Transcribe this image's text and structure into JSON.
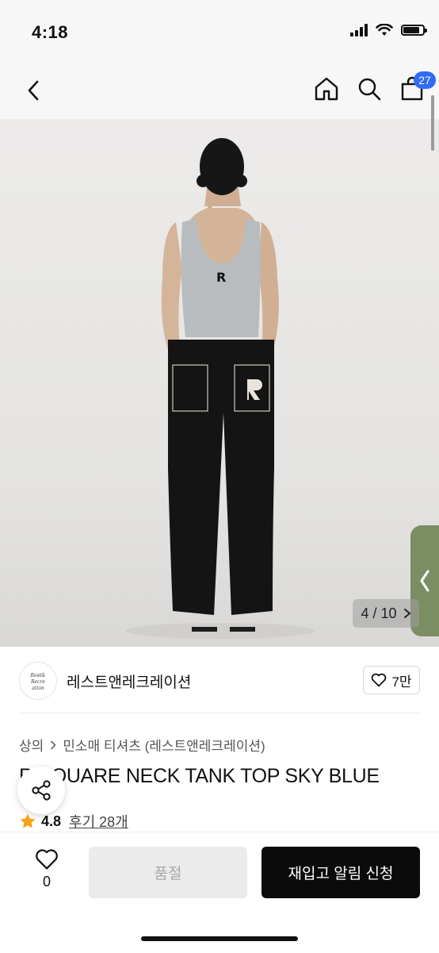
{
  "status_bar": {
    "time": "4:18",
    "battery_level": 0.85
  },
  "nav": {
    "back_icon": "chevron-left-icon",
    "home_icon": "home-icon",
    "search_icon": "search-icon",
    "cart_icon": "shopping-bag-icon",
    "cart_count": "27"
  },
  "gallery": {
    "current": "4",
    "total": "10",
    "counter_text": "4 / 10"
  },
  "brand": {
    "name": "레스트앤레크레이션",
    "likes": "7만"
  },
  "breadcrumb": {
    "category": "상의",
    "subcategory": "민소매 티셔츠 (레스트앤레크레이션)"
  },
  "product": {
    "title": "R SQUARE NECK TANK TOP SKY BLUE",
    "rating": "4.8",
    "reviews": "후기 28개"
  },
  "bottom_bar": {
    "wish_count": "0",
    "soldout_label": "품절",
    "restock_label": "재입고 알림 신청"
  },
  "colors": {
    "accent_blue": "#2f6bf5",
    "primary_black": "#0b0b0b",
    "disabled_gray": "#ebebeb",
    "star_orange": "#f6a21b",
    "side_tab_green": "#7b8d63"
  }
}
